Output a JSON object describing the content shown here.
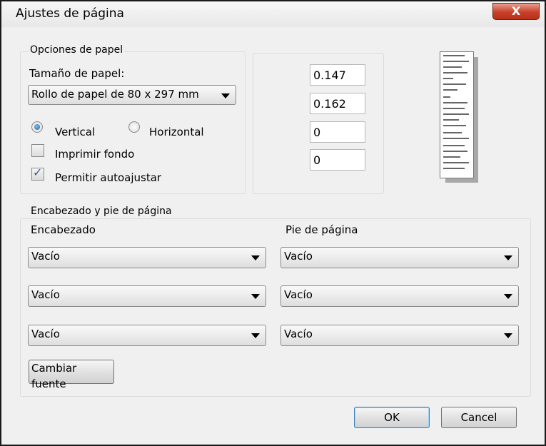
{
  "window": {
    "title": "Ajustes de página",
    "close_label": "X"
  },
  "paper": {
    "group_label": "Opciones de papel",
    "size_label": "Tamaño de papel:",
    "size_value": "Rollo de papel de 80 x 297 mm",
    "orientation": {
      "vertical_label": "Vertical",
      "horizontal_label": "Horizontal",
      "selected": "Vertical"
    },
    "print_background_label": "Imprimir fondo",
    "print_background_checked": false,
    "autofit_label": "Permitir autoajustar",
    "autofit_checked": true,
    "check_glyph": "✓"
  },
  "margins": {
    "values": [
      "0.147",
      "0.162",
      "0",
      "0"
    ]
  },
  "header_footer": {
    "group_label": "Encabezado y pie de página",
    "header_label": "Encabezado",
    "footer_label": "Pie de página",
    "header_values": [
      "Vacío",
      "Vacío",
      "Vacío"
    ],
    "footer_values": [
      "Vacío",
      "Vacío",
      "Vacío"
    ],
    "change_font_label": "Cambiar fuente"
  },
  "buttons": {
    "ok_label": "OK",
    "cancel_label": "Cancel"
  },
  "colors": {
    "accent_radio": "#1c5e9a",
    "close_button": "#c8402a",
    "ok_border": "#3c7fb1"
  }
}
